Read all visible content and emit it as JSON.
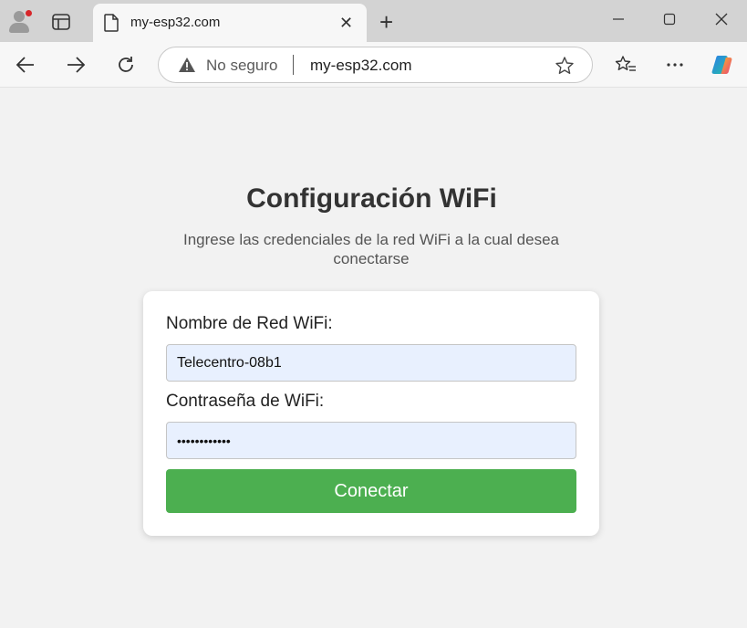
{
  "browser": {
    "tab_title": "my-esp32.com",
    "security_text": "No seguro",
    "url": "my-esp32.com"
  },
  "page": {
    "heading": "Configuración WiFi",
    "subtitle": "Ingrese las credenciales de la red WiFi a la cual desea conectarse",
    "ssid_label": "Nombre de Red WiFi:",
    "ssid_value": "Telecentro-08b1",
    "password_label": "Contraseña de WiFi:",
    "password_value": "••••••••••••",
    "connect_button": "Conectar"
  },
  "colors": {
    "button": "#4caf50",
    "input_bg": "#e8f0fe",
    "page_bg": "#f2f2f2"
  }
}
